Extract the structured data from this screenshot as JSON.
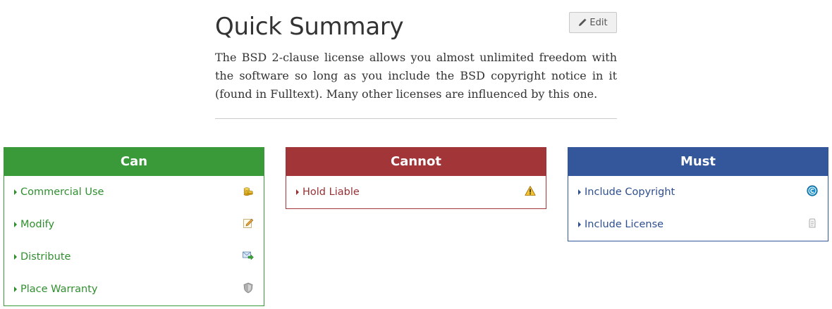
{
  "summary": {
    "title": "Quick Summary",
    "edit_label": "Edit",
    "description": "The BSD 2-clause license allows you almost unlimited freedom with the software so long as you include the BSD copyright notice in it (found in Fulltext). Many other licenses are influenced by this one."
  },
  "panels": {
    "can": {
      "title": "Can",
      "color": "#3a9a3a",
      "items": [
        {
          "label": "Commercial Use",
          "icon": "coins-icon"
        },
        {
          "label": "Modify",
          "icon": "edit-pencil-icon"
        },
        {
          "label": "Distribute",
          "icon": "send-envelope-icon"
        },
        {
          "label": "Place Warranty",
          "icon": "shield-icon"
        }
      ]
    },
    "cannot": {
      "title": "Cannot",
      "color": "#a23538",
      "items": [
        {
          "label": "Hold Liable",
          "icon": "warning-icon"
        }
      ]
    },
    "must": {
      "title": "Must",
      "color": "#34579c",
      "items": [
        {
          "label": "Include Copyright",
          "icon": "copyright-icon"
        },
        {
          "label": "Include License",
          "icon": "license-icon"
        }
      ]
    }
  }
}
